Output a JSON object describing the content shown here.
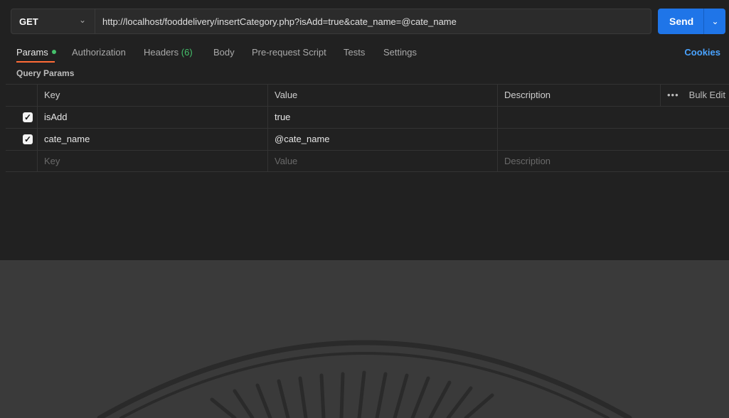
{
  "request": {
    "method": "GET",
    "url": "http://localhost/fooddelivery/insertCategory.php?isAdd=true&cate_name=@cate_name",
    "send_label": "Send"
  },
  "tabs": [
    {
      "label": "Params",
      "active": true
    },
    {
      "label": "Authorization"
    },
    {
      "label": "Headers",
      "count": "(6)"
    },
    {
      "label": "Body"
    },
    {
      "label": "Pre-request Script"
    },
    {
      "label": "Tests"
    },
    {
      "label": "Settings"
    }
  ],
  "cookies_label": "Cookies",
  "query_params": {
    "title": "Query Params",
    "columns": {
      "key": "Key",
      "value": "Value",
      "description": "Description"
    },
    "bulk_edit": "Bulk Edit",
    "more": "•••",
    "rows": [
      {
        "checked": true,
        "key": "isAdd",
        "value": "true",
        "description": ""
      },
      {
        "checked": true,
        "key": "cate_name",
        "value": "@cate_name",
        "description": ""
      }
    ],
    "placeholders": {
      "key": "Key",
      "value": "Value",
      "description": "Description"
    }
  },
  "colors": {
    "accent": "#ff6c37",
    "send": "#1f75e8",
    "green": "#45c06b",
    "link": "#4aa3ff"
  }
}
